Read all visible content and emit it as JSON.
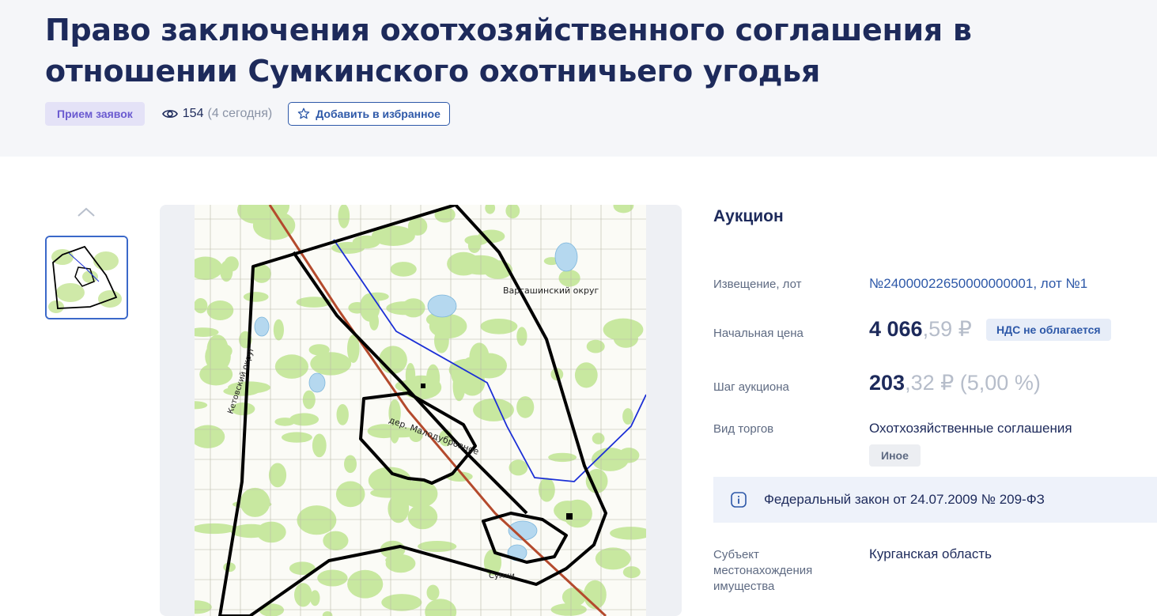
{
  "header": {
    "title": "Право заключения охотхозяйственного соглашения в отношении Сумкинского охотничьего угодья",
    "status_badge": "Прием заявок",
    "views_count": "154",
    "views_today": "(4 сегодня)",
    "favorite_label": "Добавить в избранное"
  },
  "gallery": {
    "thumbnail_count": 1,
    "map_labels": {
      "village_1": "дер. Малодубровное",
      "district": "Варгашинский округ",
      "district_2": "Кетовский округ",
      "town": "Сумки"
    }
  },
  "info": {
    "procedure_type": "Аукцион",
    "notice": {
      "label": "Извещение, лот",
      "value": "№24000022650000000001, лот №1"
    },
    "start_price": {
      "label": "Начальная цена",
      "main": "4 066",
      "cents": ",59 ₽",
      "vat": "НДС не облагается"
    },
    "auction_step": {
      "label": "Шаг аукциона",
      "main": "203",
      "cents": ",32 ₽ (5,00 %)"
    },
    "trade_type": {
      "label": "Вид торгов",
      "value": "Охотхозяйственные соглашения",
      "badge": "Иное"
    },
    "law": "Федеральный закон от 24.07.2009 № 209-ФЗ",
    "subject": {
      "label": "Субъект местонахождения имущества",
      "value": "Курганская область"
    }
  },
  "colors": {
    "accent": "#2d58a8",
    "title": "#1d2a5b",
    "status_badge_bg": "#e4e2f7",
    "status_badge_text": "#6a5ad0"
  },
  "icons": [
    "eye-icon",
    "star-icon",
    "chevron-up-icon",
    "info-icon"
  ]
}
